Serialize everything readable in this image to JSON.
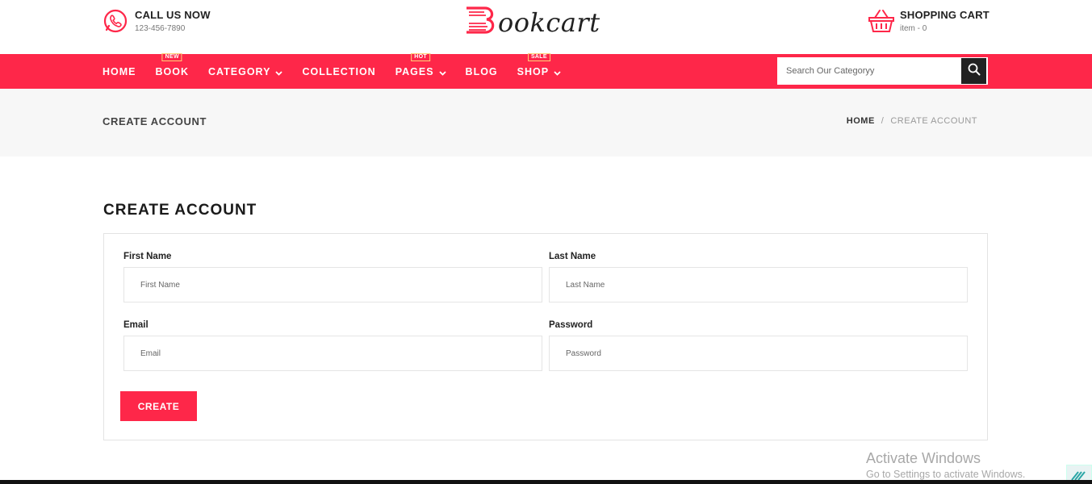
{
  "header": {
    "call_title": "CALL US NOW",
    "call_number": "123-456-7890",
    "logo_text": "ookcart",
    "cart_title": "SHOPPING CART",
    "cart_items": "item - 0"
  },
  "nav": {
    "items": [
      {
        "label": "HOME",
        "badge": null,
        "dropdown": false
      },
      {
        "label": "BOOK",
        "badge": "NEW",
        "dropdown": false
      },
      {
        "label": "CATEGORY",
        "badge": null,
        "dropdown": true
      },
      {
        "label": "COLLECTION",
        "badge": null,
        "dropdown": false
      },
      {
        "label": "PAGES",
        "badge": "HOT",
        "dropdown": true
      },
      {
        "label": "BLOG",
        "badge": null,
        "dropdown": false
      },
      {
        "label": "SHOP",
        "badge": "SALE",
        "dropdown": true
      }
    ],
    "search_placeholder": "Search Our Categoryy",
    "search_icon": "search-icon"
  },
  "breadcrumb": {
    "title": "CREATE ACCOUNT",
    "home": "HOME",
    "separator": "/",
    "current": "CREATE ACCOUNT"
  },
  "main": {
    "heading": "CREATE ACCOUNT",
    "fields": {
      "first_name_label": "First Name",
      "first_name_placeholder": "First Name",
      "last_name_label": "Last Name",
      "last_name_placeholder": "Last Name",
      "email_label": "Email",
      "email_placeholder": "Email",
      "password_label": "Password",
      "password_placeholder": "Password"
    },
    "create_label": "CREATE"
  },
  "watermark": {
    "title": "Activate Windows",
    "subtitle": "Go to Settings to activate Windows."
  },
  "colors": {
    "accent": "#fe2749",
    "dark": "#222222",
    "band": "#f7f7f7"
  }
}
